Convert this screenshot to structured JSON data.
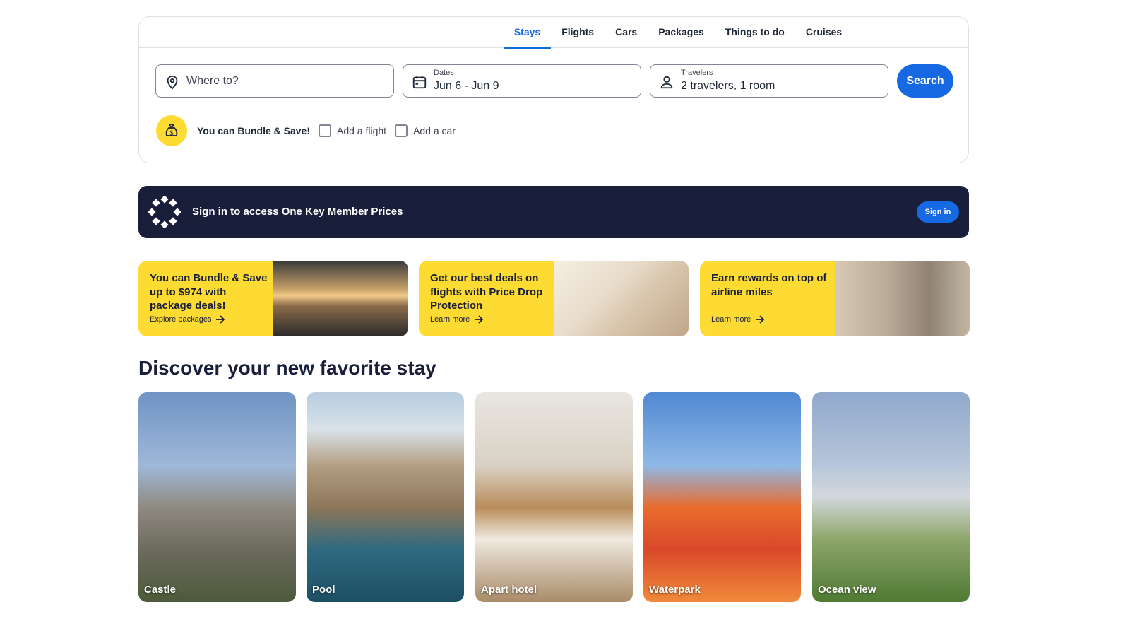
{
  "tabs": [
    {
      "label": "Stays",
      "active": true
    },
    {
      "label": "Flights",
      "active": false
    },
    {
      "label": "Cars",
      "active": false
    },
    {
      "label": "Packages",
      "active": false
    },
    {
      "label": "Things to do",
      "active": false
    },
    {
      "label": "Cruises",
      "active": false
    }
  ],
  "search": {
    "where_placeholder": "Where to?",
    "dates_label": "Dates",
    "dates_value": "Jun 6 - Jun 9",
    "travelers_label": "Travelers",
    "travelers_value": "2 travelers, 1 room",
    "button_label": "Search"
  },
  "bundle": {
    "text": "You can Bundle & Save!",
    "add_flight": "Add a flight",
    "add_car": "Add a car"
  },
  "signin_banner": {
    "message": "Sign in to access One Key Member Prices",
    "button_label": "Sign in"
  },
  "promos": [
    {
      "text": "You can Bundle & Save up to $974 with package deals!",
      "link": "Explore packages"
    },
    {
      "text": "Get our best deals on flights with Price Drop Protection",
      "link": "Learn more"
    },
    {
      "text": "Earn rewards on top of airline miles",
      "link": "Learn more"
    }
  ],
  "discover": {
    "title": "Discover your new favorite stay",
    "tiles": [
      "Castle",
      "Pool",
      "Apart hotel",
      "Waterpark",
      "Ocean view"
    ]
  },
  "colors": {
    "accent": "#1668e3",
    "navy": "#191e3b",
    "yellow": "#fddb32"
  }
}
